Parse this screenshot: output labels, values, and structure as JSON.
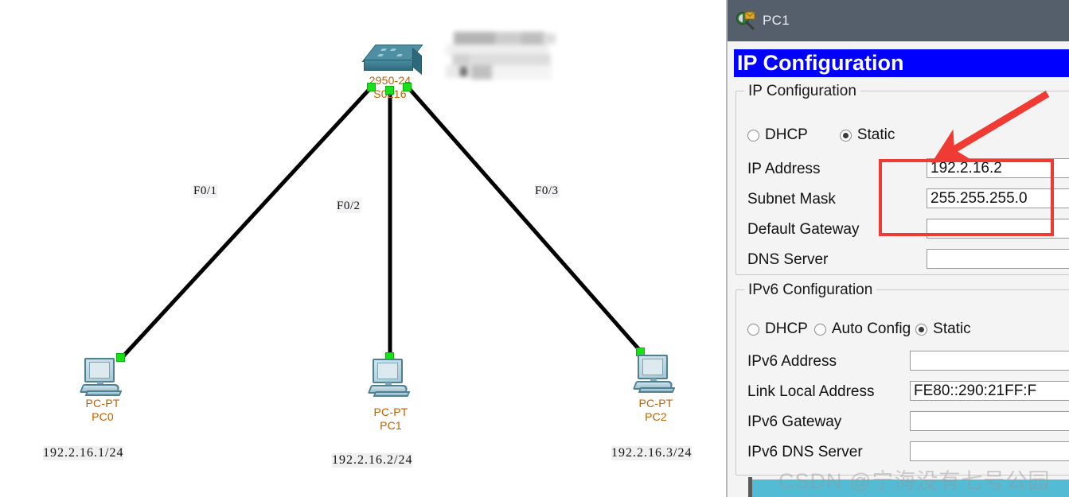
{
  "topology": {
    "switch": {
      "model_label": "2950-24",
      "name_label": "S0216",
      "icon": "switch-icon"
    },
    "pcs": [
      {
        "type_label": "PC-PT",
        "name_label": "PC0",
        "ip_note": "192.2.16.1/24",
        "icon": "pc-icon"
      },
      {
        "type_label": "PC-PT",
        "name_label": "PC1",
        "ip_note": "192.2.16.2/24",
        "icon": "pc-icon"
      },
      {
        "type_label": "PC-PT",
        "name_label": "PC2",
        "ip_note": "192.2.16.3/24",
        "icon": "pc-icon"
      }
    ],
    "port_labels": [
      "F0/1",
      "F0/2",
      "F0/3"
    ]
  },
  "window": {
    "title": "PC1",
    "title_icon": "magnifier-envelope-icon",
    "header": "IP Configuration"
  },
  "ipv4": {
    "legend": "IP Configuration",
    "mode_options": [
      "DHCP",
      "Static"
    ],
    "mode_selected": "Static",
    "fields": [
      {
        "label": "IP Address",
        "value": "192.2.16.2"
      },
      {
        "label": "Subnet Mask",
        "value": "255.255.255.0"
      },
      {
        "label": "Default Gateway",
        "value": ""
      },
      {
        "label": "DNS Server",
        "value": ""
      }
    ]
  },
  "ipv6": {
    "legend": "IPv6 Configuration",
    "mode_options": [
      "DHCP",
      "Auto Config",
      "Static"
    ],
    "mode_selected": "Static",
    "fields": [
      {
        "label": "IPv6 Address",
        "value": ""
      },
      {
        "label": "Link Local Address",
        "value": "FE80::290:21FF:F"
      },
      {
        "label": "IPv6 Gateway",
        "value": ""
      },
      {
        "label": "IPv6 DNS Server",
        "value": ""
      }
    ]
  },
  "annotation": {
    "arrow_color": "#ef3b33",
    "highlight_color": "#ef3b33"
  },
  "watermark": {
    "text": "CSDN @宁海没有七号公园"
  },
  "colors": {
    "header_blue": "#0000ff",
    "titlebar": "#545f6b",
    "led_green": "#19e019",
    "teal": "#53bcd4",
    "caption_orange": "#c06000"
  }
}
